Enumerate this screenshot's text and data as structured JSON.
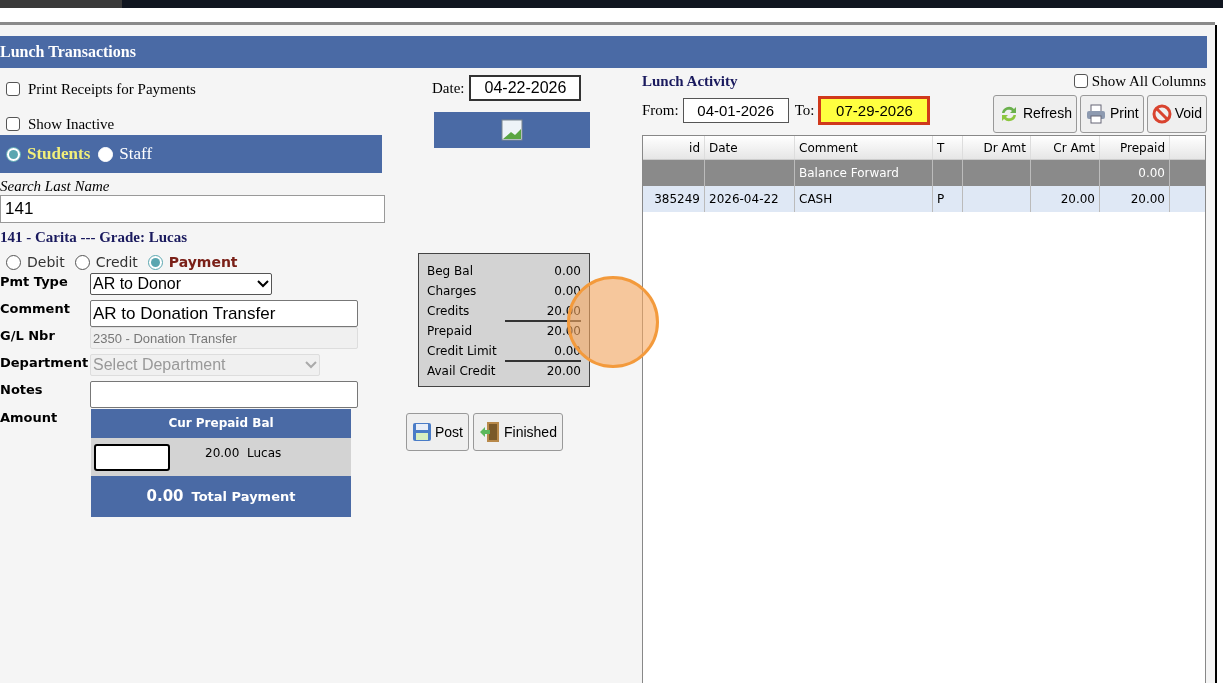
{
  "title": "Lunch Transactions",
  "options": [
    {
      "label": "Print Receipts for Payments",
      "checked": false
    },
    {
      "label": "Show Inactive",
      "checked": false
    }
  ],
  "date": {
    "label": "Date:",
    "value": "04-22-2026"
  },
  "person_types": [
    {
      "label": "Students",
      "selected": true
    },
    {
      "label": "Staff",
      "selected": false
    }
  ],
  "search": {
    "label": "Search Last Name",
    "value": "141"
  },
  "student_heading": "141 - Carita --- Grade: Lucas",
  "txn_types": [
    {
      "label": "Debit",
      "selected": false
    },
    {
      "label": "Credit",
      "selected": false
    },
    {
      "label": "Payment",
      "selected": true
    }
  ],
  "form": [
    {
      "label": "Pmt Type",
      "kind": "select",
      "value": "AR to Donor",
      "disabled": false
    },
    {
      "label": "Comment",
      "kind": "text",
      "value": "AR to Donation Transfer",
      "disabled": false
    },
    {
      "label": "G/L Nbr",
      "kind": "text",
      "value": "2350 - Donation Transfer",
      "disabled": true
    },
    {
      "label": "Department",
      "kind": "select",
      "placeholder": "Select Department",
      "disabled": true
    },
    {
      "label": "Notes",
      "kind": "text",
      "disabled": false
    }
  ],
  "amount": {
    "label": "Amount",
    "header": "Cur Prepaid Bal",
    "balance": "20.00",
    "name": "Lucas",
    "total": "0.00",
    "total_label": "Total Payment"
  },
  "summary": [
    {
      "label": "Beg Bal",
      "value": "0.00",
      "rule": false
    },
    {
      "label": "Charges",
      "value": "0.00",
      "rule": false
    },
    {
      "label": "Credits",
      "value": "20.00",
      "rule": false
    },
    {
      "label": "Prepaid",
      "value": "20.00",
      "rule": true
    },
    {
      "label": "Credit Limit",
      "value": "0.00",
      "rule": false
    },
    {
      "label": "Avail Credit",
      "value": "20.00",
      "rule": true
    }
  ],
  "actions": [
    {
      "label": "Post",
      "kind": "save"
    },
    {
      "label": "Finished",
      "kind": "exit"
    }
  ],
  "activity": {
    "title": "Lunch Activity",
    "from_label": "From:",
    "from": "04-01-2026",
    "to_label": "To:",
    "to": "07-29-2026",
    "show_all_columns": {
      "label": "Show All Columns",
      "checked": false
    },
    "buttons": [
      {
        "label": "Refresh",
        "kind": "refresh"
      },
      {
        "label": "Print",
        "kind": "print"
      },
      {
        "label": "Void",
        "kind": "void"
      }
    ],
    "columns": [
      "id",
      "Date",
      "Comment",
      "T",
      "Dr Amt",
      "Cr Amt",
      "Prepaid"
    ],
    "rows": [
      {
        "kind": "balance",
        "cells": [
          "",
          "",
          "Balance Forward",
          "",
          "",
          "",
          "0.00"
        ]
      },
      {
        "kind": "entry",
        "cells": [
          "385249",
          "2026-04-22",
          "CASH",
          "P",
          "",
          "20.00",
          "20.00"
        ]
      }
    ]
  }
}
